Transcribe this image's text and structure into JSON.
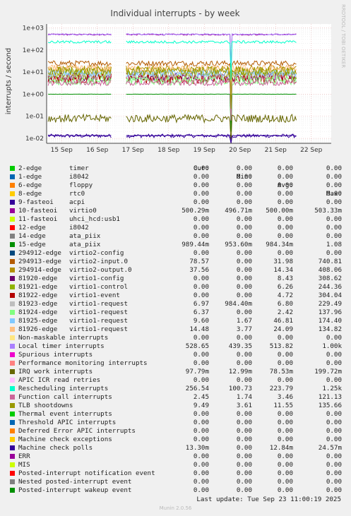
{
  "title": "Individual interrupts - by week",
  "side_label": "RRDTOOL / TOBI OETIKER",
  "footer": "Munin 2.0.56",
  "last_update": "Last update: Tue Sep 23 11:00:19 2025",
  "legend_headers": {
    "cur": "Cur:",
    "min": "Min:",
    "avg": "Avg:",
    "max": "Max:"
  },
  "chart_data": {
    "type": "line",
    "title": "Individual interrupts - by week",
    "ylabel": "interrupts / second",
    "y_scale": "log",
    "ylim": [
      0.006,
      1500
    ],
    "y_ticks": [
      {
        "value": 0.01,
        "label": "1e-02"
      },
      {
        "value": 0.1,
        "label": "1e-01"
      },
      {
        "value": 1,
        "label": "1e+00"
      },
      {
        "value": 10,
        "label": "1e+01"
      },
      {
        "value": 100,
        "label": "1e+02"
      },
      {
        "value": 1000,
        "label": "1e+03"
      }
    ],
    "x_range_days": [
      0,
      7
    ],
    "x_ticks": [
      {
        "day": 0.5,
        "label": "15 Sep"
      },
      {
        "day": 1.5,
        "label": "16 Sep"
      },
      {
        "day": 2.5,
        "label": "17 Sep"
      },
      {
        "day": 3.5,
        "label": "18 Sep"
      },
      {
        "day": 4.5,
        "label": "19 Sep"
      },
      {
        "day": 5.5,
        "label": "20 Sep"
      },
      {
        "day": 6.5,
        "label": "21 Sep"
      },
      {
        "day": 7.5,
        "label": "22 Sep"
      }
    ],
    "gaps": [
      [
        1.9,
        2.3
      ]
    ],
    "spike_day": 5.25,
    "grid": true,
    "legend_placement": "below",
    "series": [
      {
        "name": "2-edge",
        "desc": "timer",
        "color": "#00cc00",
        "cur": "0.00",
        "min": "0.00",
        "avg": "0.00",
        "max": "0.00"
      },
      {
        "name": "1-edge",
        "desc": "i8042",
        "color": "#0066b3",
        "cur": "0.00",
        "min": "0.00",
        "avg": "0.00",
        "max": "0.00"
      },
      {
        "name": "6-edge",
        "desc": "floppy",
        "color": "#ff8000",
        "cur": "0.00",
        "min": "0.00",
        "avg": "0.00",
        "max": "0.00"
      },
      {
        "name": "8-edge",
        "desc": "rtc0",
        "color": "#ffcc00",
        "cur": "0.00",
        "min": "0.00",
        "avg": "0.00",
        "max": "0.00"
      },
      {
        "name": "9-fasteoi",
        "desc": "acpi",
        "color": "#330099",
        "cur": "0.00",
        "min": "0.00",
        "avg": "0.00",
        "max": "0.00",
        "level": 0.013,
        "noise": 0.08
      },
      {
        "name": "10-fasteoi",
        "desc": "virtio0",
        "color": "#990099",
        "cur": "500.29m",
        "min": "496.71m",
        "avg": "500.00m",
        "max": "503.33m",
        "level": 500,
        "noise": 0.03
      },
      {
        "name": "11-fasteoi",
        "desc": "uhci_hcd:usb1",
        "color": "#ccff00",
        "cur": "0.00",
        "min": "0.00",
        "avg": "0.00",
        "max": "0.00"
      },
      {
        "name": "12-edge",
        "desc": "i8042",
        "color": "#ff0000",
        "cur": "0.00",
        "min": "0.00",
        "avg": "0.00",
        "max": "0.00"
      },
      {
        "name": "14-edge",
        "desc": "ata_piix",
        "color": "#808080",
        "cur": "0.00",
        "min": "0.00",
        "avg": "0.00",
        "max": "0.00"
      },
      {
        "name": "15-edge",
        "desc": "ata_piix",
        "color": "#008f00",
        "cur": "989.44m",
        "min": "953.60m",
        "avg": "984.34m",
        "max": "1.08",
        "level": 1.0,
        "noise": 0.005
      },
      {
        "name": "294912-edge",
        "desc": "virtio2-config",
        "color": "#00487d",
        "cur": "0.00",
        "min": "0.00",
        "avg": "0.00",
        "max": "0.00"
      },
      {
        "name": "294913-edge",
        "desc": "virtio2-input.0",
        "color": "#b35a00",
        "cur": "78.57",
        "min": "0.00",
        "avg": "31.98",
        "max": "740.81",
        "level": 25,
        "noise": 0.12
      },
      {
        "name": "294914-edge",
        "desc": "virtio2-output.0",
        "color": "#b38f00",
        "cur": "37.56",
        "min": "0.00",
        "avg": "14.34",
        "max": "408.06",
        "level": 14,
        "noise": 0.15
      },
      {
        "name": "81920-edge",
        "desc": "virtio1-config",
        "color": "#6b006b",
        "cur": "0.00",
        "min": "0.00",
        "avg": "8.43",
        "max": "308.62",
        "level": 6,
        "noise": 0.2
      },
      {
        "name": "81921-edge",
        "desc": "virtio1-control",
        "color": "#8fb300",
        "cur": "0.00",
        "min": "0.00",
        "avg": "6.26",
        "max": "244.36",
        "level": 8,
        "noise": 0.25
      },
      {
        "name": "81922-edge",
        "desc": "virtio1-event",
        "color": "#b30000",
        "cur": "0.00",
        "min": "0.00",
        "avg": "4.72",
        "max": "304.04",
        "level": 5,
        "noise": 0.22
      },
      {
        "name": "81923-edge",
        "desc": "virtio1-request",
        "color": "#bebebe",
        "cur": "6.97",
        "min": "984.40m",
        "avg": "6.80",
        "max": "229.49",
        "level": 7,
        "noise": 0.18
      },
      {
        "name": "81924-edge",
        "desc": "virtio1-request",
        "color": "#80ff80",
        "cur": "6.37",
        "min": "0.00",
        "avg": "2.42",
        "max": "137.96",
        "level": 4,
        "noise": 0.2
      },
      {
        "name": "81925-edge",
        "desc": "virtio1-request",
        "color": "#80c9ff",
        "cur": "9.60",
        "min": "1.67",
        "avg": "46.81",
        "max": "174.40",
        "level": 9,
        "noise": 0.15
      },
      {
        "name": "81926-edge",
        "desc": "virtio1-request",
        "color": "#ffc080",
        "cur": "14.48",
        "min": "3.77",
        "avg": "24.09",
        "max": "134.82",
        "level": 14,
        "noise": 0.18
      },
      {
        "name": "Non-maskable interrupts",
        "desc": "",
        "color": "#ffe680",
        "cur": "0.00",
        "min": "0.00",
        "avg": "0.00",
        "max": "0.00"
      },
      {
        "name": "Local timer interrupts",
        "desc": "",
        "color": "#aa80ff",
        "cur": "528.65",
        "min": "439.35",
        "avg": "513.82",
        "max": "1.00k",
        "level": 510,
        "noise": 0.03
      },
      {
        "name": "Spurious interrupts",
        "desc": "",
        "color": "#ee00cc",
        "cur": "0.00",
        "min": "0.00",
        "avg": "0.00",
        "max": "0.00"
      },
      {
        "name": "Performance monitoring interrupts",
        "desc": "",
        "color": "#ff8080",
        "cur": "0.00",
        "min": "0.00",
        "avg": "0.00",
        "max": "0.00"
      },
      {
        "name": "IRQ work interrupts",
        "desc": "",
        "color": "#666600",
        "cur": "97.79m",
        "min": "12.99m",
        "avg": "78.53m",
        "max": "199.72m",
        "level": 0.08,
        "noise": 0.18
      },
      {
        "name": "APIC ICR read retries",
        "desc": "",
        "color": "#ffbfff",
        "cur": "0.00",
        "min": "0.00",
        "avg": "0.00",
        "max": "0.00"
      },
      {
        "name": "Rescheduling interrupts",
        "desc": "",
        "color": "#00ffcc",
        "cur": "256.54",
        "min": "100.73",
        "avg": "223.79",
        "max": "1.25k",
        "level": 230,
        "noise": 0.06
      },
      {
        "name": "Function call interrupts",
        "desc": "",
        "color": "#cc6699",
        "cur": "2.45",
        "min": "1.74",
        "avg": "3.46",
        "max": "121.13",
        "level": 3.2,
        "noise": 0.12
      },
      {
        "name": "TLB shootdowns",
        "desc": "",
        "color": "#999900",
        "cur": "9.49",
        "min": "3.61",
        "avg": "11.55",
        "max": "135.66",
        "level": 11,
        "noise": 0.2
      },
      {
        "name": "Thermal event interrupts",
        "desc": "",
        "color": "#00cc00",
        "cur": "0.00",
        "min": "0.00",
        "avg": "0.00",
        "max": "0.00"
      },
      {
        "name": "Threshold APIC interrupts",
        "desc": "",
        "color": "#0066b3",
        "cur": "0.00",
        "min": "0.00",
        "avg": "0.00",
        "max": "0.00"
      },
      {
        "name": "Deferred Error APIC interrupts",
        "desc": "",
        "color": "#ff8000",
        "cur": "0.00",
        "min": "0.00",
        "avg": "0.00",
        "max": "0.00"
      },
      {
        "name": "Machine check exceptions",
        "desc": "",
        "color": "#ffcc00",
        "cur": "0.00",
        "min": "0.00",
        "avg": "0.00",
        "max": "0.00"
      },
      {
        "name": "Machine check polls",
        "desc": "",
        "color": "#330099",
        "cur": "13.30m",
        "min": "0.00",
        "avg": "12.84m",
        "max": "24.57m",
        "level": 0.0135,
        "noise": 0.02
      },
      {
        "name": "ERR",
        "desc": "",
        "color": "#990099",
        "cur": "0.00",
        "min": "0.00",
        "avg": "0.00",
        "max": "0.00"
      },
      {
        "name": "MIS",
        "desc": "",
        "color": "#ccff00",
        "cur": "0.00",
        "min": "0.00",
        "avg": "0.00",
        "max": "0.00"
      },
      {
        "name": "Posted-interrupt notification event",
        "desc": "",
        "color": "#ff0000",
        "cur": "0.00",
        "min": "0.00",
        "avg": "0.00",
        "max": "0.00"
      },
      {
        "name": "Nested posted-interrupt event",
        "desc": "",
        "color": "#808080",
        "cur": "0.00",
        "min": "0.00",
        "avg": "0.00",
        "max": "0.00"
      },
      {
        "name": "Posted-interrupt wakeup event",
        "desc": "",
        "color": "#008f00",
        "cur": "0.00",
        "min": "0.00",
        "avg": "0.00",
        "max": "0.00"
      }
    ]
  }
}
